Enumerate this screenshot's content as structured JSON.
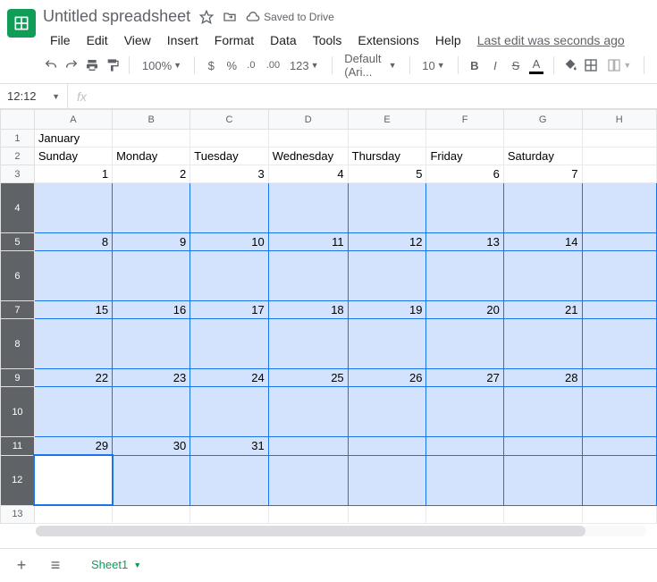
{
  "header": {
    "title": "Untitled spreadsheet",
    "saved_label": "Saved to Drive",
    "last_edit": "Last edit was seconds ago",
    "menus": [
      "File",
      "Edit",
      "View",
      "Insert",
      "Format",
      "Data",
      "Tools",
      "Extensions",
      "Help"
    ]
  },
  "toolbar": {
    "zoom": "100%",
    "font": "Default (Ari...",
    "font_size": "10"
  },
  "formula_bar": {
    "name_box": "12:12",
    "fx_label": "fx"
  },
  "grid": {
    "columns": [
      "A",
      "B",
      "C",
      "D",
      "E",
      "F",
      "G",
      "H"
    ],
    "row_headers": [
      "1",
      "2",
      "3",
      "4",
      "5",
      "6",
      "7",
      "8",
      "9",
      "10",
      "11",
      "12",
      "13"
    ],
    "row_heights": [
      "short",
      "short",
      "short",
      "tall",
      "short",
      "tall",
      "short",
      "tall",
      "short",
      "tall",
      "short",
      "tall",
      "short"
    ],
    "selected_rows": [
      4,
      5,
      6,
      7,
      8,
      9,
      10,
      11,
      12
    ],
    "active_row": 12,
    "cells": {
      "1": [
        "January",
        "",
        "",
        "",
        "",
        "",
        "",
        ""
      ],
      "2": [
        "Sunday",
        "Monday",
        "Tuesday",
        "Wednesday",
        "Thursday",
        "Friday",
        "Saturday",
        ""
      ],
      "3": [
        "1",
        "2",
        "3",
        "4",
        "5",
        "6",
        "7",
        ""
      ],
      "4": [
        "",
        "",
        "",
        "",
        "",
        "",
        "",
        ""
      ],
      "5": [
        "8",
        "9",
        "10",
        "11",
        "12",
        "13",
        "14",
        ""
      ],
      "6": [
        "",
        "",
        "",
        "",
        "",
        "",
        "",
        ""
      ],
      "7": [
        "15",
        "16",
        "17",
        "18",
        "19",
        "20",
        "21",
        ""
      ],
      "8": [
        "",
        "",
        "",
        "",
        "",
        "",
        "",
        ""
      ],
      "9": [
        "22",
        "23",
        "24",
        "25",
        "26",
        "27",
        "28",
        ""
      ],
      "10": [
        "",
        "",
        "",
        "",
        "",
        "",
        "",
        ""
      ],
      "11": [
        "29",
        "30",
        "31",
        "",
        "",
        "",
        "",
        ""
      ],
      "12": [
        "",
        "",
        "",
        "",
        "",
        "",
        "",
        ""
      ],
      "13": [
        "",
        "",
        "",
        "",
        "",
        "",
        "",
        ""
      ]
    },
    "numeric_rows": [
      3,
      5,
      7,
      9,
      11
    ]
  },
  "sheets": {
    "active": "Sheet1"
  }
}
